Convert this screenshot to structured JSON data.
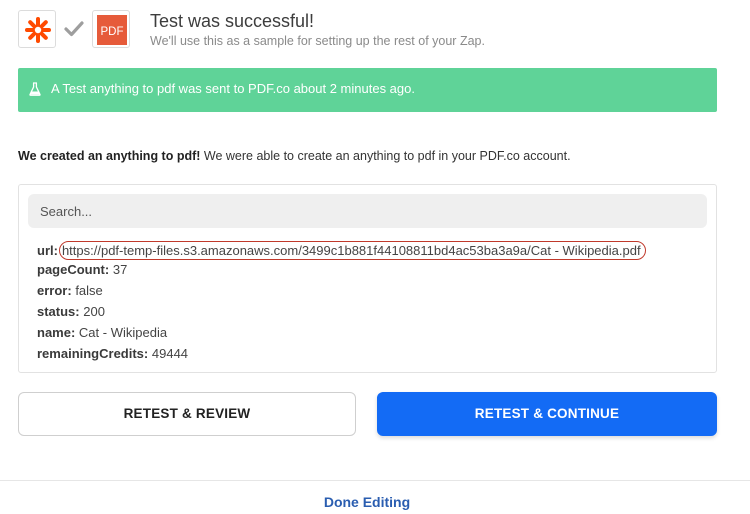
{
  "header": {
    "title": "Test was successful!",
    "subtitle": "We'll use this as a sample for setting up the rest of your Zap.",
    "pdf_icon_text": "PDF",
    "colors": {
      "zapier_orange": "#ff4a00",
      "pdfco_red": "#e65b3a",
      "check_gray": "#9e9e9e"
    }
  },
  "banner": {
    "icon": "flask-icon",
    "text": "A Test anything to pdf was sent to PDF.co about 2 minutes ago.",
    "color": "#5fd398"
  },
  "created": {
    "bold_text": "We created an anything to pdf!",
    "rest_text": " We were able to create an anything to pdf in your PDF.co account."
  },
  "data_box": {
    "search_placeholder": "Search...",
    "fields": [
      {
        "key": "url:",
        "value": "https://pdf-temp-files.s3.amazonaws.com/3499c1b881f44108811bd4ac53ba3a9a/Cat - Wikipedia.pdf"
      },
      {
        "key": "pageCount:",
        "value": "37"
      },
      {
        "key": "error:",
        "value": "false"
      },
      {
        "key": "status:",
        "value": "200"
      },
      {
        "key": "name:",
        "value": "Cat - Wikipedia"
      },
      {
        "key": "remainingCredits:",
        "value": "49444"
      }
    ]
  },
  "buttons": {
    "retest_review": "RETEST & REVIEW",
    "retest_continue": "RETEST & CONTINUE",
    "continue_color": "#136bf5"
  },
  "footer": {
    "done_label": "Done Editing"
  }
}
